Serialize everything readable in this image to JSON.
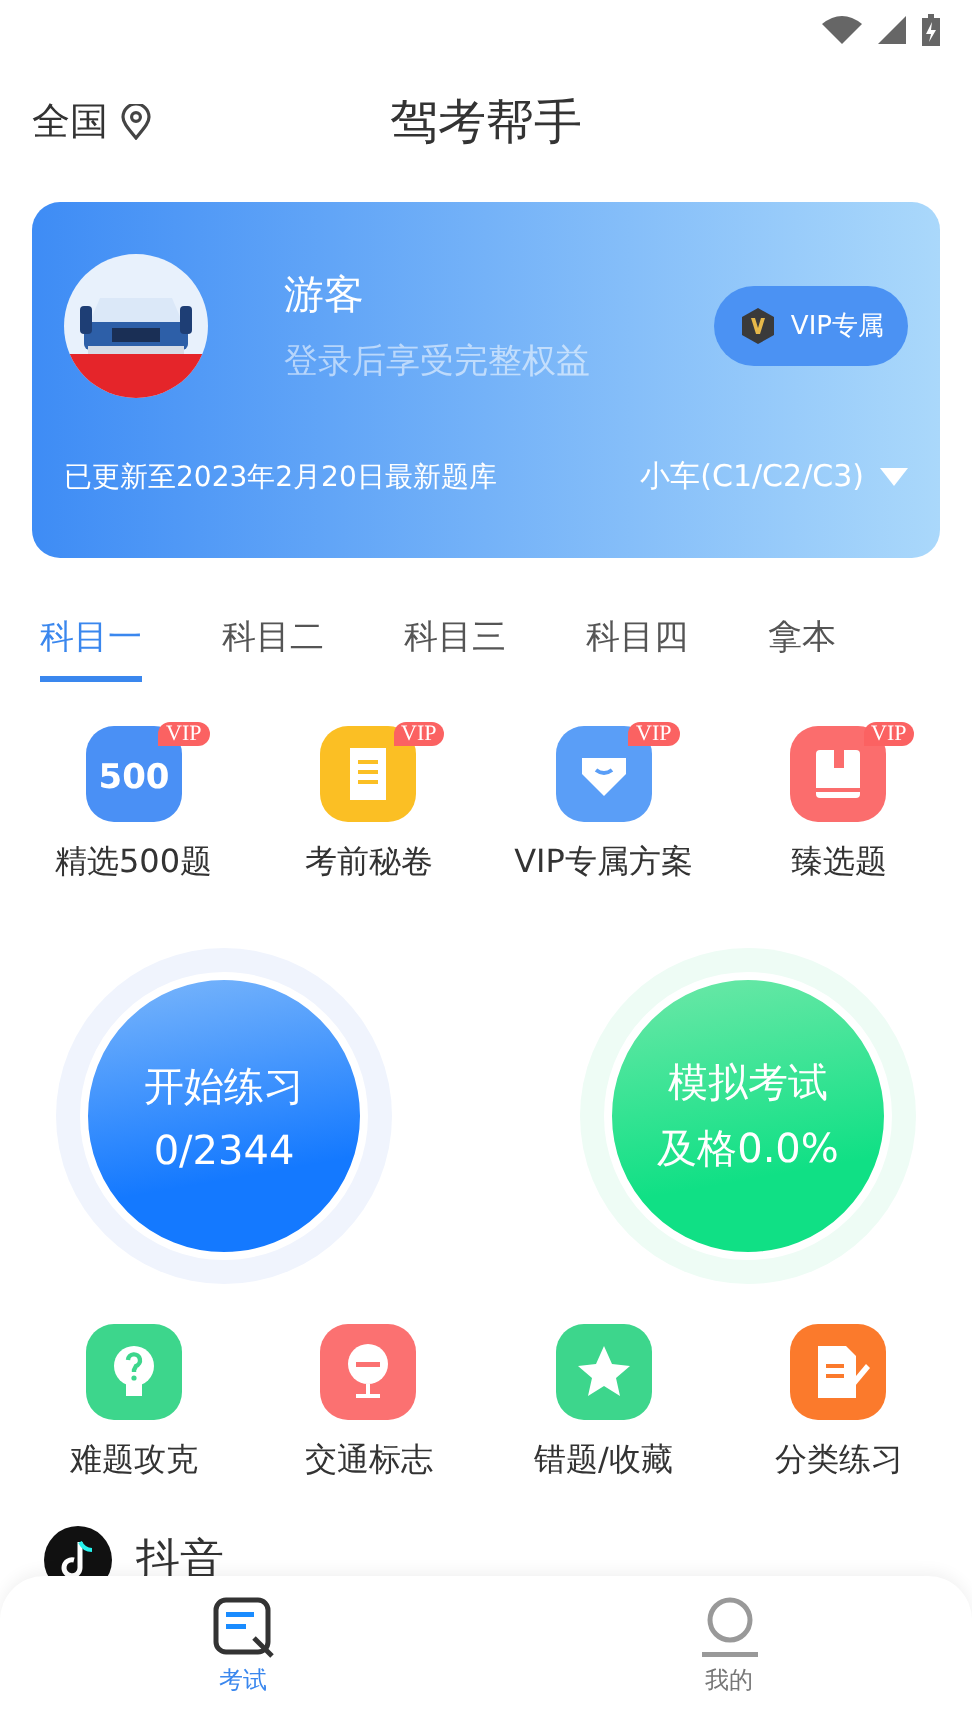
{
  "header": {
    "location": "全国",
    "title": "驾考帮手"
  },
  "profile": {
    "name": "游客",
    "subtitle": "登录后享受完整权益",
    "vip_button": "VIP专属",
    "update_note": "已更新至2023年2月20日最新题库",
    "car_type": "小车(C1/C2/C3)"
  },
  "subject_tabs": [
    {
      "label": "科目一",
      "selected": true
    },
    {
      "label": "科目二",
      "selected": false
    },
    {
      "label": "科目三",
      "selected": false
    },
    {
      "label": "科目四",
      "selected": false
    },
    {
      "label": "拿本",
      "selected": false
    }
  ],
  "vip_features": [
    {
      "kind": "count",
      "label": "精选500题",
      "icon_text": "500",
      "badge": "VIP",
      "color": "#4a90f5"
    },
    {
      "kind": "scroll",
      "label": "考前秘卷",
      "badge": "VIP",
      "color": "#fbbf24"
    },
    {
      "kind": "diamond",
      "label": "VIP专属方案",
      "badge": "VIP",
      "color": "#5a9ef7"
    },
    {
      "kind": "book",
      "label": "臻选题",
      "badge": "VIP",
      "color": "#fb6d6d"
    }
  ],
  "practice_circles": [
    {
      "kind": "blue",
      "title": "开始练习",
      "value": "0/2344"
    },
    {
      "kind": "green",
      "title": "模拟考试",
      "value": "及格0.0%"
    }
  ],
  "tools": [
    {
      "kind": "bulb",
      "label": "难题攻克",
      "color": "#3dd68c"
    },
    {
      "kind": "sign",
      "label": "交通标志",
      "color": "#fb7171"
    },
    {
      "kind": "star",
      "label": "错题/收藏",
      "color": "#3dd68c"
    },
    {
      "kind": "note",
      "label": "分类练习",
      "color": "#fb7a2c"
    }
  ],
  "partial_row": {
    "label": "抖音"
  },
  "bottom_tabs": [
    {
      "kind": "exam",
      "label": "考试",
      "selected": true
    },
    {
      "kind": "me",
      "label": "我的",
      "selected": false
    }
  ]
}
